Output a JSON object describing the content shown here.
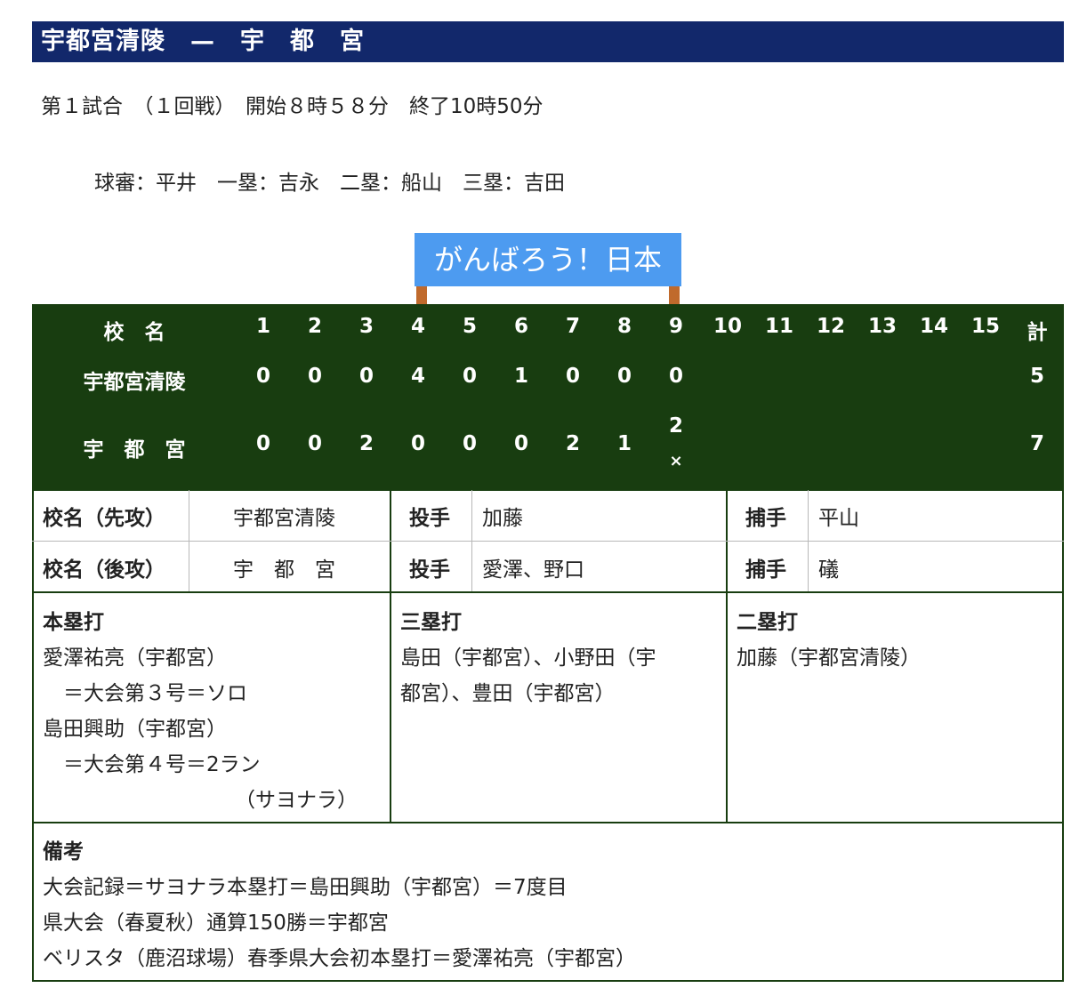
{
  "title": "宇都宮清陵　—　宇　都　宮",
  "game_info": "第１試合　（１回戦）　開始８時５８分　終了10時50分",
  "umpires": "球審：平井　一塁：吉永　二塁：船山　三塁：吉田",
  "sign": "がんばろう！日本",
  "scoreboard": {
    "header_name": "校　名",
    "innings": [
      "1",
      "2",
      "3",
      "4",
      "5",
      "6",
      "7",
      "8",
      "9",
      "10",
      "11",
      "12",
      "13",
      "14",
      "15"
    ],
    "total_label": "計",
    "teams": [
      {
        "name": "宇都宮清陵",
        "scores": [
          "0",
          "0",
          "0",
          "4",
          "0",
          "1",
          "0",
          "0",
          "0"
        ],
        "total": "5"
      },
      {
        "name": "宇　都　宮",
        "scores": [
          "0",
          "0",
          "2",
          "0",
          "0",
          "0",
          "2",
          "1",
          "2"
        ],
        "total": "7",
        "walkoff_mark": "×"
      }
    ]
  },
  "lineup": {
    "rows": [
      {
        "label": "校名（先攻）",
        "team": "宇都宮清陵",
        "pitcher_label": "投手",
        "pitcher": "加藤",
        "catcher_label": "捕手",
        "catcher": "平山"
      },
      {
        "label": "校名（後攻）",
        "team": "宇　都　宮",
        "pitcher_label": "投手",
        "pitcher": "愛澤、野口",
        "catcher_label": "捕手",
        "catcher": "礒"
      }
    ]
  },
  "hits": {
    "hr_title": "本塁打",
    "hr_lines": [
      "愛澤祐亮（宇都宮）",
      "　＝大会第３号＝ソロ",
      "島田興助（宇都宮）",
      "　＝大会第４号＝2ラン",
      "（サヨナラ）"
    ],
    "triple_title": "三塁打",
    "triple_lines": [
      "島田（宇都宮）、小野田（宇",
      "都宮）、豊田（宇都宮）"
    ],
    "double_title": "二塁打",
    "double_lines": [
      "加藤（宇都宮清陵）"
    ]
  },
  "remarks": {
    "title": "備考",
    "lines": [
      "大会記録＝サヨナラ本塁打＝島田興助（宇都宮）＝7度目",
      "県大会（春夏秋）通算150勝＝宇都宮",
      "ベリスタ（鹿沼球場）春季県大会初本塁打＝愛澤祐亮（宇都宮）"
    ]
  },
  "colors": {
    "title_bg": "#12286b",
    "scoreboard_bg": "#183d10",
    "sign_bg": "#4d9bf0",
    "post": "#c06a2c"
  }
}
